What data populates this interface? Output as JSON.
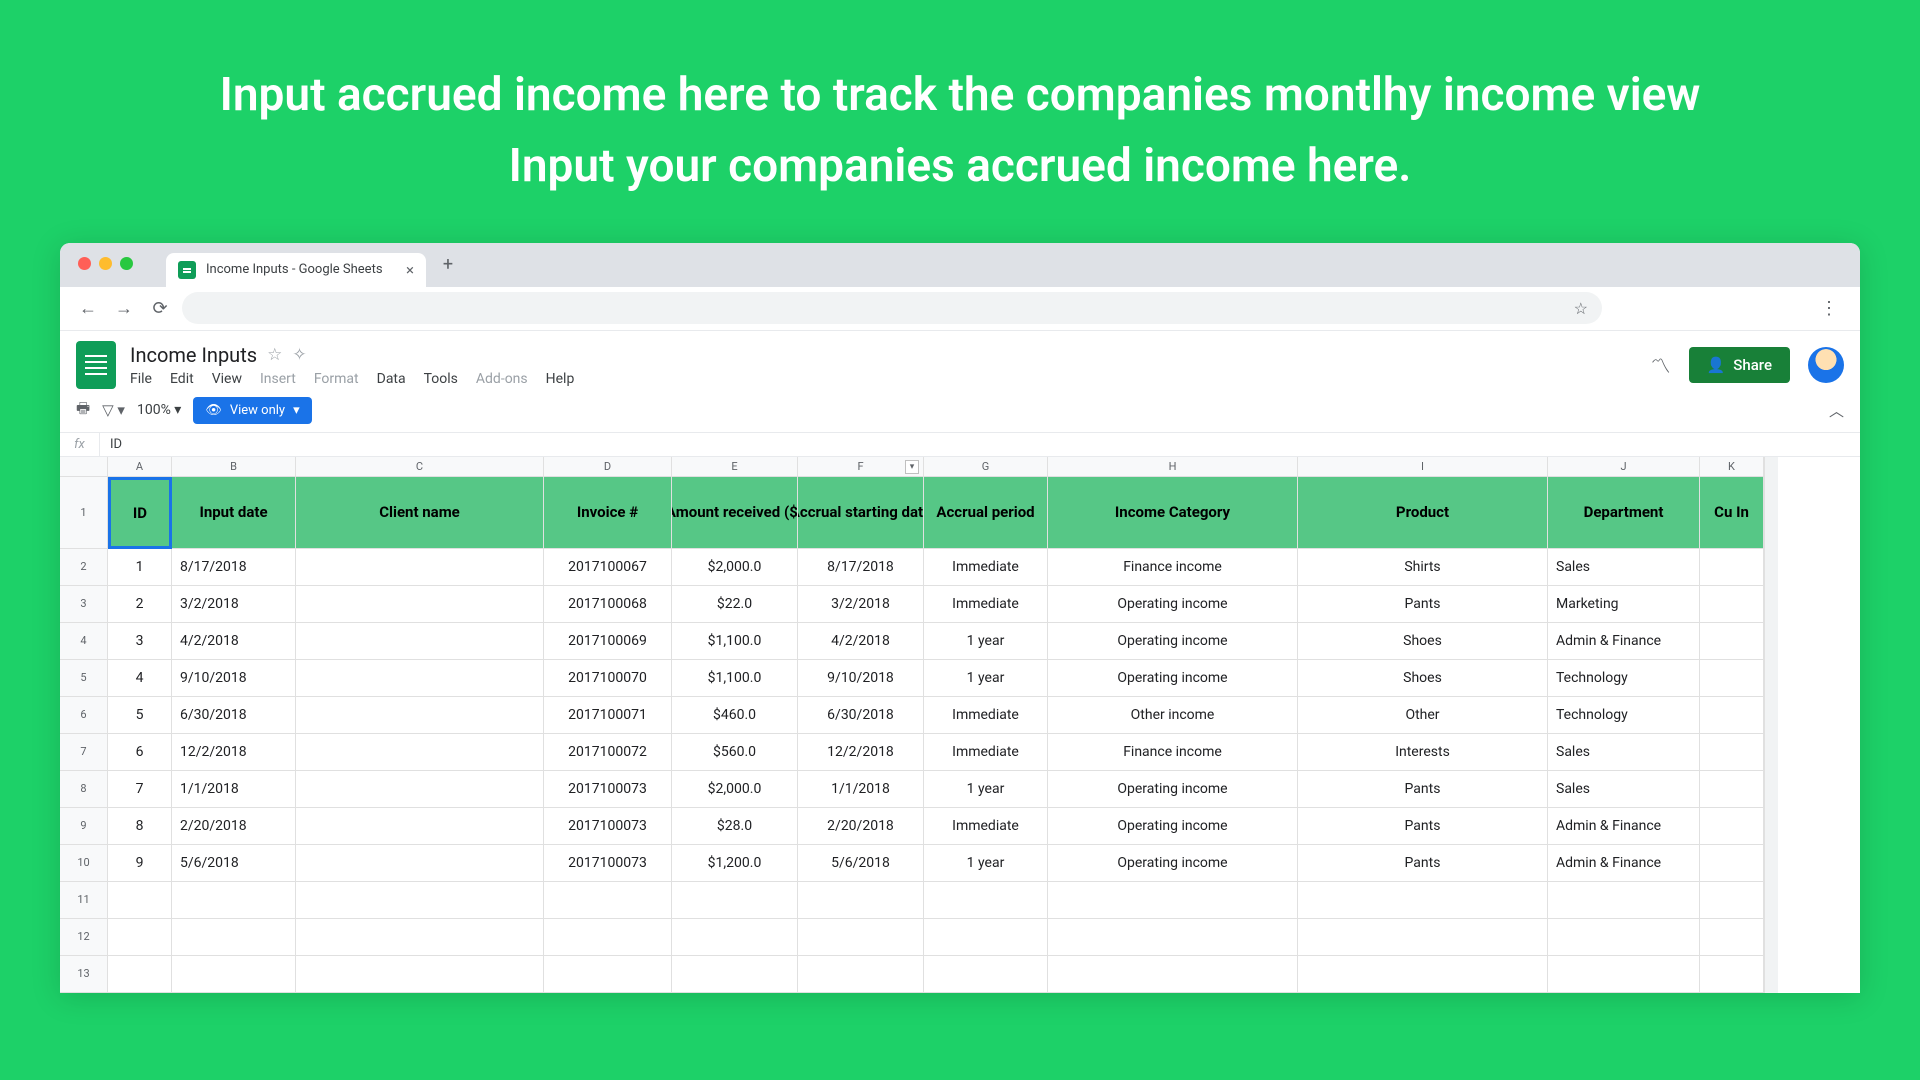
{
  "promo": "Input accrued income here to track the companies montlhy income view Input your companies accrued income here.",
  "browser": {
    "tab_title": "Income Inputs - Google Sheets",
    "url": ""
  },
  "doc": {
    "title": "Income Inputs",
    "menus": [
      "File",
      "Edit",
      "View",
      "Insert",
      "Format",
      "Data",
      "Tools",
      "Add-ons",
      "Help"
    ],
    "share_label": "Share",
    "zoom": "100%",
    "view_only": "View only",
    "fx_value": "ID"
  },
  "sheet": {
    "col_letters": [
      "A",
      "B",
      "C",
      "D",
      "E",
      "F",
      "G",
      "H",
      "I",
      "J",
      "K"
    ],
    "headers": [
      "ID",
      "Input date",
      "Client name",
      "Invoice #",
      "Amount received ($)",
      "Accrual starting date",
      "Accrual period",
      "Income Category",
      "Product",
      "Department",
      "Cu In"
    ],
    "rows": [
      {
        "n": 1,
        "A": "1",
        "B": "8/17/2018",
        "C": "",
        "D": "2017100067",
        "E": "$2,000.0",
        "F": "8/17/2018",
        "G": "Immediate",
        "H": "Finance income",
        "I": "Shirts",
        "J": "Sales"
      },
      {
        "n": 2,
        "A": "2",
        "B": "3/2/2018",
        "C": "",
        "D": "2017100068",
        "E": "$22.0",
        "F": "3/2/2018",
        "G": "Immediate",
        "H": "Operating income",
        "I": "Pants",
        "J": "Marketing"
      },
      {
        "n": 3,
        "A": "3",
        "B": "4/2/2018",
        "C": "",
        "D": "2017100069",
        "E": "$1,100.0",
        "F": "4/2/2018",
        "G": "1 year",
        "H": "Operating income",
        "I": "Shoes",
        "J": "Admin & Finance"
      },
      {
        "n": 4,
        "A": "4",
        "B": "9/10/2018",
        "C": "",
        "D": "2017100070",
        "E": "$1,100.0",
        "F": "9/10/2018",
        "G": "1 year",
        "H": "Operating income",
        "I": "Shoes",
        "J": "Technology"
      },
      {
        "n": 5,
        "A": "5",
        "B": "6/30/2018",
        "C": "",
        "D": "2017100071",
        "E": "$460.0",
        "F": "6/30/2018",
        "G": "Immediate",
        "H": "Other income",
        "I": "Other",
        "J": "Technology"
      },
      {
        "n": 6,
        "A": "6",
        "B": "12/2/2018",
        "C": "",
        "D": "2017100072",
        "E": "$560.0",
        "F": "12/2/2018",
        "G": "Immediate",
        "H": "Finance income",
        "I": "Interests",
        "J": "Sales"
      },
      {
        "n": 7,
        "A": "7",
        "B": "1/1/2018",
        "C": "",
        "D": "2017100073",
        "E": "$2,000.0",
        "F": "1/1/2018",
        "G": "1 year",
        "H": "Operating income",
        "I": "Pants",
        "J": "Sales"
      },
      {
        "n": 8,
        "A": "8",
        "B": "2/20/2018",
        "C": "",
        "D": "2017100073",
        "E": "$28.0",
        "F": "2/20/2018",
        "G": "Immediate",
        "H": "Operating income",
        "I": "Pants",
        "J": "Admin & Finance"
      },
      {
        "n": 9,
        "A": "9",
        "B": "5/6/2018",
        "C": "",
        "D": "2017100073",
        "E": "$1,200.0",
        "F": "5/6/2018",
        "G": "1 year",
        "H": "Operating income",
        "I": "Pants",
        "J": "Admin & Finance"
      }
    ],
    "empty_rows": [
      11,
      12,
      13
    ]
  },
  "chart_data": {
    "type": "table",
    "title": "Income Inputs",
    "columns": [
      "ID",
      "Input date",
      "Client name",
      "Invoice #",
      "Amount received ($)",
      "Accrual starting date",
      "Accrual period",
      "Income Category",
      "Product",
      "Department"
    ],
    "rows": [
      [
        1,
        "8/17/2018",
        "",
        "2017100067",
        2000.0,
        "8/17/2018",
        "Immediate",
        "Finance income",
        "Shirts",
        "Sales"
      ],
      [
        2,
        "3/2/2018",
        "",
        "2017100068",
        22.0,
        "3/2/2018",
        "Immediate",
        "Operating income",
        "Pants",
        "Marketing"
      ],
      [
        3,
        "4/2/2018",
        "",
        "2017100069",
        1100.0,
        "4/2/2018",
        "1 year",
        "Operating income",
        "Shoes",
        "Admin & Finance"
      ],
      [
        4,
        "9/10/2018",
        "",
        "2017100070",
        1100.0,
        "9/10/2018",
        "1 year",
        "Operating income",
        "Shoes",
        "Technology"
      ],
      [
        5,
        "6/30/2018",
        "",
        "2017100071",
        460.0,
        "6/30/2018",
        "Immediate",
        "Other income",
        "Other",
        "Technology"
      ],
      [
        6,
        "12/2/2018",
        "",
        "2017100072",
        560.0,
        "12/2/2018",
        "Immediate",
        "Finance income",
        "Interests",
        "Sales"
      ],
      [
        7,
        "1/1/2018",
        "",
        "2017100073",
        2000.0,
        "1/1/2018",
        "1 year",
        "Operating income",
        "Pants",
        "Sales"
      ],
      [
        8,
        "2/20/2018",
        "",
        "2017100073",
        28.0,
        "2/20/2018",
        "Immediate",
        "Operating income",
        "Pants",
        "Admin & Finance"
      ],
      [
        9,
        "5/6/2018",
        "",
        "2017100073",
        1200.0,
        "5/6/2018",
        "1 year",
        "Operating income",
        "Pants",
        "Admin & Finance"
      ]
    ]
  }
}
